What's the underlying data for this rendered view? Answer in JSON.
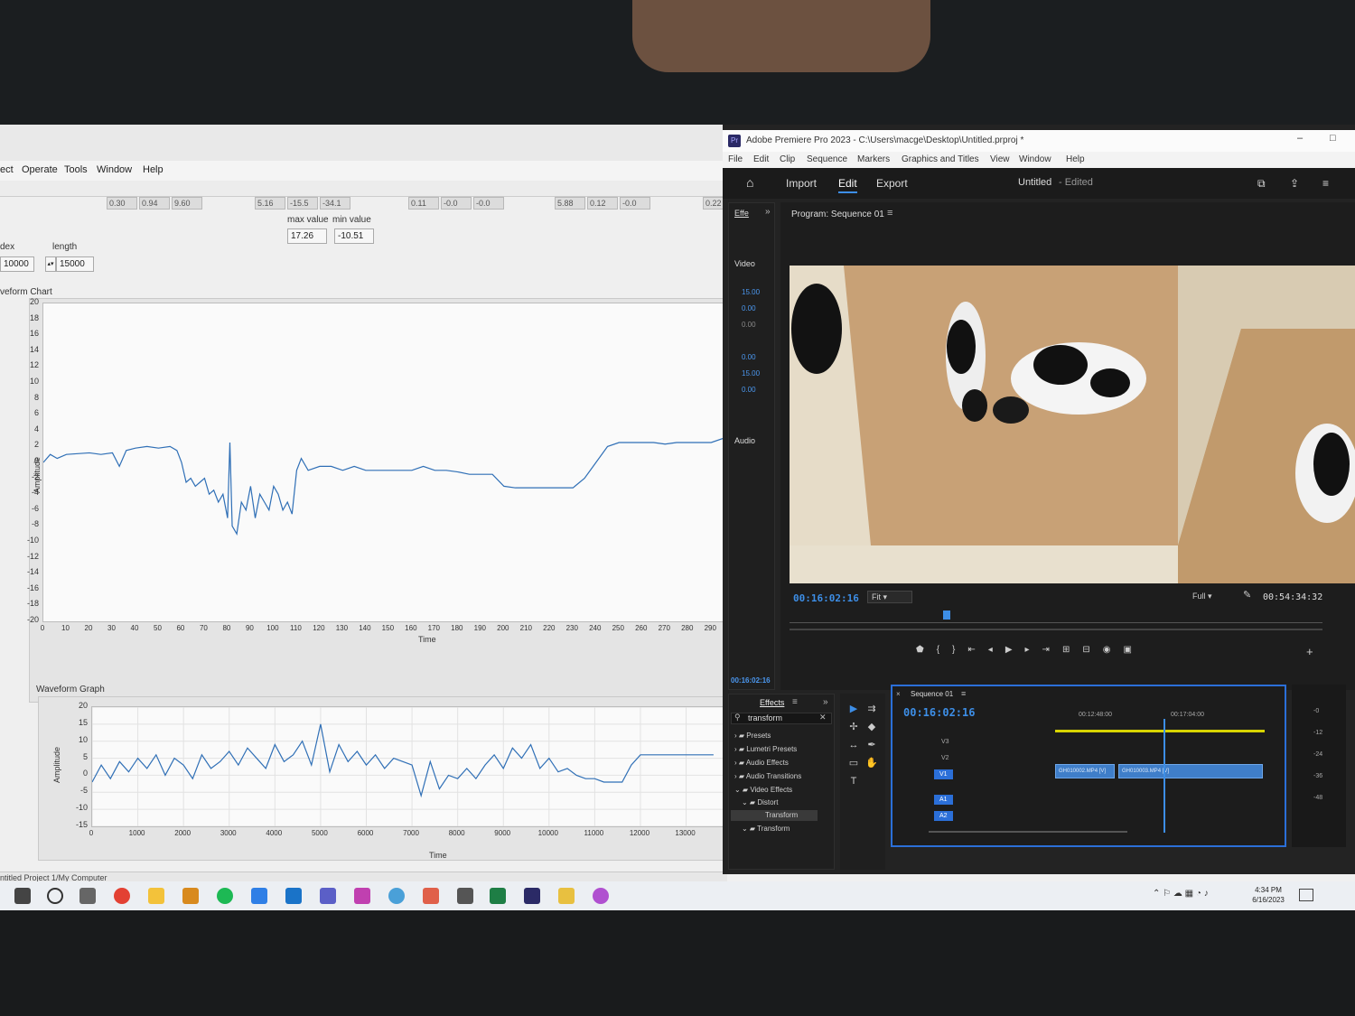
{
  "labview": {
    "menu": [
      "ect",
      "Operate",
      "Tools",
      "Window",
      "Help"
    ],
    "top_readouts": [
      "0.30",
      "0.94",
      "9.60",
      "5.16",
      "-15.5",
      "-34.1",
      "0.11",
      "-0.0",
      "-0.0",
      "5.88",
      "0.12",
      "-0.0",
      "0.22"
    ],
    "max_label": "max value",
    "min_label": "min value",
    "max_value": "17.26",
    "min_value": "-10.51",
    "index_label": "dex",
    "index_value": "10000",
    "length_label": "length",
    "length_value": "15000",
    "chart_title": "veform Chart",
    "graph_title": "Waveform Graph",
    "status": "ntitled Project 1/My Computer"
  },
  "chart_data": [
    {
      "type": "line",
      "title": "veform Chart",
      "xlabel": "Time",
      "ylabel": "Amplitude",
      "xlim": [
        0,
        295
      ],
      "ylim": [
        -20,
        20
      ],
      "grid": false,
      "y_ticks": [
        "20",
        "18",
        "16",
        "14",
        "12",
        "10",
        "8",
        "6",
        "4",
        "2",
        "0",
        "-2",
        "-4",
        "-6",
        "-8",
        "-10",
        "-12",
        "-14",
        "-16",
        "-18",
        "-20"
      ],
      "x_ticks": [
        "0",
        "10",
        "20",
        "30",
        "40",
        "50",
        "60",
        "70",
        "80",
        "90",
        "100",
        "110",
        "120",
        "130",
        "140",
        "150",
        "160",
        "170",
        "180",
        "190",
        "200",
        "210",
        "220",
        "230",
        "240",
        "250",
        "260",
        "270",
        "280",
        "290"
      ],
      "series": [
        {
          "x": [
            0,
            3,
            6,
            10,
            20,
            25,
            30,
            33,
            36,
            40,
            45,
            50,
            55,
            58,
            60,
            62,
            64,
            66,
            68,
            70,
            72,
            74,
            76,
            78,
            80,
            81,
            82,
            84,
            86,
            88,
            90,
            92,
            94,
            96,
            98,
            100,
            102,
            104,
            106,
            108,
            110,
            112,
            115,
            120,
            125,
            130,
            135,
            140,
            145,
            150,
            155,
            160,
            165,
            170,
            175,
            180,
            185,
            190,
            195,
            200,
            205,
            210,
            215,
            220,
            225,
            230,
            235,
            240,
            245,
            250,
            255,
            260,
            265,
            270,
            275,
            280,
            285,
            290,
            295
          ],
          "y": [
            0,
            1,
            0.5,
            1,
            1.2,
            1,
            1.2,
            -0.5,
            1.5,
            1.8,
            2,
            1.8,
            2,
            1.5,
            0,
            -2.5,
            -2,
            -3,
            -2.5,
            -2,
            -4,
            -3.5,
            -5,
            -4,
            -7,
            2.5,
            -8,
            -9,
            -5,
            -6,
            -3,
            -7,
            -4,
            -5,
            -6,
            -3,
            -4,
            -6,
            -5,
            -6.5,
            -1,
            0.5,
            -1,
            -0.5,
            -0.5,
            -1,
            -0.5,
            -1,
            -1,
            -1,
            -1,
            -1,
            -0.5,
            -1,
            -1,
            -1.2,
            -1.5,
            -1.5,
            -1.5,
            -3,
            -3.2,
            -3.2,
            -3.2,
            -3.2,
            -3.2,
            -3.2,
            -2,
            0,
            2,
            2.5,
            2.5,
            2.5,
            2.5,
            2.3,
            2.5,
            2.5,
            2.5,
            2.5,
            3
          ]
        }
      ]
    },
    {
      "type": "line",
      "title": "Waveform Graph",
      "xlabel": "Time",
      "ylabel": "Amplitude",
      "xlim": [
        0,
        13800
      ],
      "ylim": [
        -15,
        20
      ],
      "grid": true,
      "y_ticks": [
        "20",
        "15",
        "10",
        "5",
        "0",
        "-5",
        "-10",
        "-15"
      ],
      "x_ticks": [
        "0",
        "1000",
        "2000",
        "3000",
        "4000",
        "5000",
        "6000",
        "7000",
        "8000",
        "9000",
        "10000",
        "11000",
        "12000",
        "13000"
      ],
      "series": [
        {
          "x": [
            0,
            200,
            400,
            600,
            800,
            1000,
            1200,
            1400,
            1600,
            1800,
            2000,
            2200,
            2400,
            2600,
            2800,
            3000,
            3200,
            3400,
            3600,
            3800,
            4000,
            4200,
            4400,
            4600,
            4800,
            5000,
            5200,
            5400,
            5600,
            5800,
            6000,
            6200,
            6400,
            6600,
            6800,
            7000,
            7200,
            7400,
            7600,
            7800,
            8000,
            8200,
            8400,
            8600,
            8800,
            9000,
            9200,
            9400,
            9600,
            9800,
            10000,
            10200,
            10400,
            10600,
            10800,
            11000,
            11200,
            11400,
            11600,
            11800,
            12000,
            12400,
            12800,
            13200,
            13600
          ],
          "y": [
            -2,
            3,
            -1,
            4,
            1,
            5,
            2,
            6,
            0,
            5,
            3,
            -1,
            6,
            2,
            4,
            7,
            3,
            8,
            5,
            2,
            9,
            4,
            6,
            10,
            3,
            15,
            1,
            9,
            4,
            7,
            3,
            6,
            2,
            5,
            4,
            3,
            -6,
            4,
            -4,
            0,
            -1,
            2,
            -1,
            3,
            6,
            2,
            8,
            5,
            9,
            2,
            5,
            1,
            2,
            0,
            -1,
            -1,
            -2,
            -2,
            -2,
            3,
            6,
            6,
            6,
            6,
            6
          ]
        }
      ]
    }
  ],
  "premiere": {
    "title": "Adobe Premiere Pro 2023 - C:\\Users\\macge\\Desktop\\Untitled.prproj *",
    "menu": [
      "File",
      "Edit",
      "Clip",
      "Sequence",
      "Markers",
      "Graphics and Titles",
      "View",
      "Window",
      "Help"
    ],
    "workspace_tabs": [
      "Import",
      "Edit",
      "Export"
    ],
    "project_name": "Untitled",
    "project_state": "- Edited",
    "left_panel_tab": "Effe",
    "left_video_label": "Video",
    "left_audio_label": "Audio",
    "left_values": [
      "15.00",
      "0.00",
      "0.00",
      "0.00",
      "15.00",
      "0.00"
    ],
    "left_timecode": "00:16:02:16",
    "program_label": "Program: Sequence 01",
    "current_timecode": "00:16:02:16",
    "fit_label": "Fit",
    "quality_label": "Full",
    "duration": "00:54:34:32",
    "effects_tab": "Effects",
    "effects_search": "transform",
    "effects_tree": [
      "Presets",
      "Lumetri Presets",
      "Audio Effects",
      "Audio Transitions",
      "Video Effects",
      "Distort",
      "Transform",
      "Transform"
    ],
    "sequence_tab": "Sequence 01",
    "sequence_timecode": "00:16:02:16",
    "ruler_marks": [
      "00:12:48:00",
      "00:17:04:00"
    ],
    "tracks": [
      "V3",
      "V2",
      "V1",
      "A1",
      "A2"
    ],
    "clips": [
      "GH010002.MP4 [V]",
      "GH010003.MP4 [V]"
    ],
    "meter_ticks": [
      "-0",
      "-12",
      "-24",
      "-36",
      "-48"
    ]
  },
  "taskbar": {
    "time": "4:34 PM",
    "date": "6/16/2023"
  },
  "colors": {
    "trace": "#2f6fb6",
    "accent": "#3d8ee6",
    "timeline_border": "#2b6fd8"
  }
}
